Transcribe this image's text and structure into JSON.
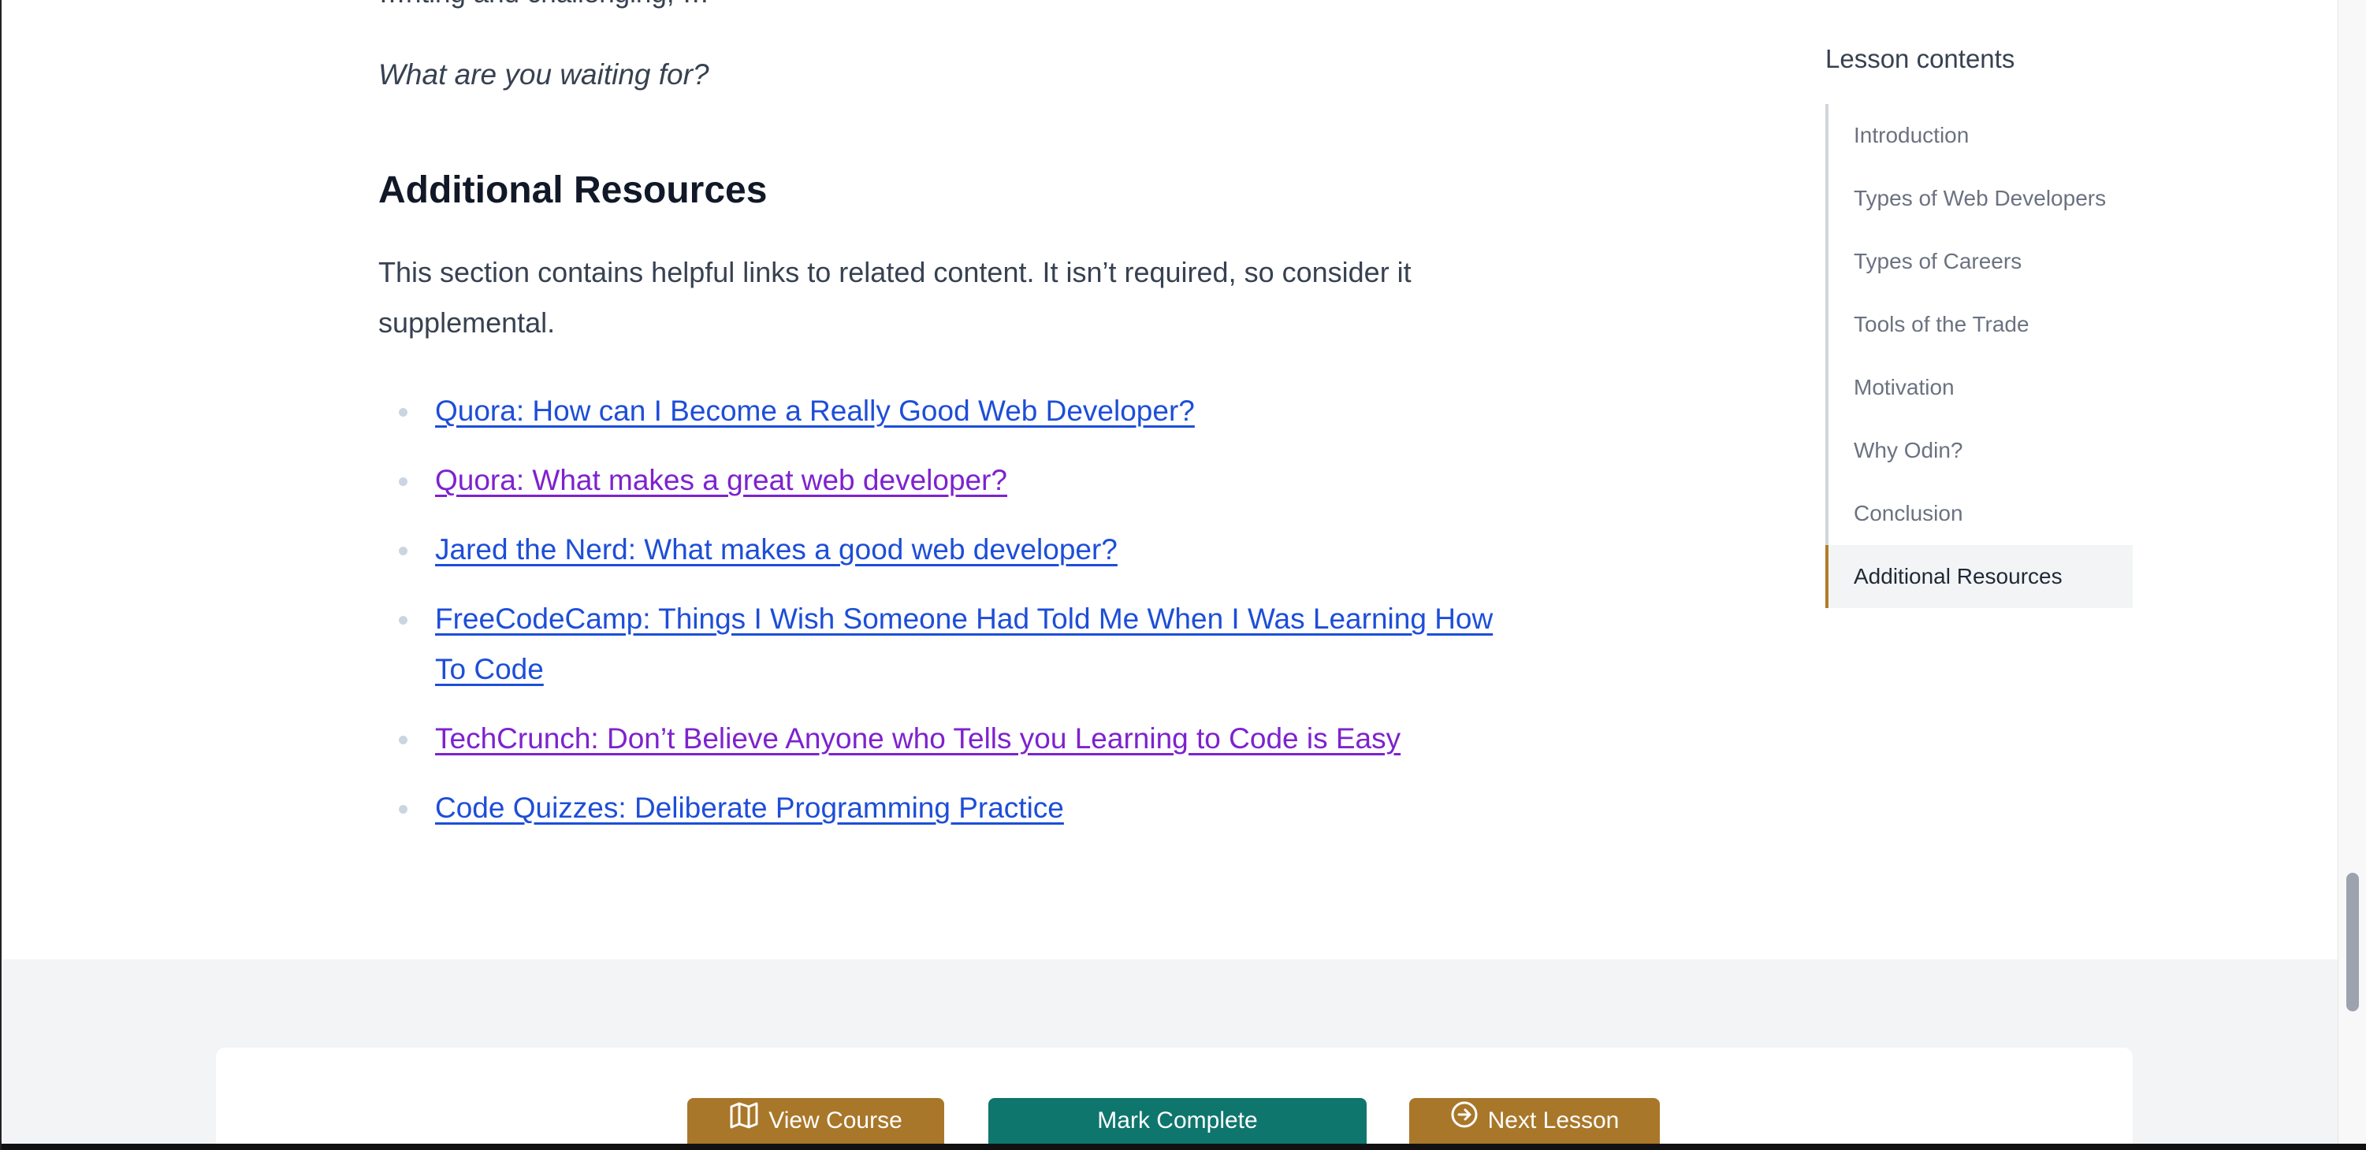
{
  "article": {
    "partial_line": "…nting and challenging, …",
    "closing_question": "What are you waiting for?",
    "section_heading": "Additional Resources",
    "section_intro": "This section contains helpful links to related content. It isn’t required, so consider it supplemental.",
    "resources": [
      {
        "label": "Quora: How can I Become a Really Good Web Developer?",
        "visited": false
      },
      {
        "label": "Quora: What makes a great web developer?",
        "visited": true
      },
      {
        "label": "Jared the Nerd: What makes a good web developer?",
        "visited": false
      },
      {
        "label": "FreeCodeCamp: Things I Wish Someone Had Told Me When I Was Learning How To Code",
        "visited": false
      },
      {
        "label": "TechCrunch: Don’t Believe Anyone who Tells you Learning to Code is Easy",
        "visited": true
      },
      {
        "label": "Code Quizzes: Deliberate Programming Practice",
        "visited": false
      }
    ]
  },
  "toc": {
    "title": "Lesson contents",
    "items": [
      {
        "label": "Introduction",
        "active": false
      },
      {
        "label": "Types of Web Developers",
        "active": false
      },
      {
        "label": "Types of Careers",
        "active": false
      },
      {
        "label": "Tools of the Trade",
        "active": false
      },
      {
        "label": "Motivation",
        "active": false
      },
      {
        "label": "Why Odin?",
        "active": false
      },
      {
        "label": "Conclusion",
        "active": false
      },
      {
        "label": "Additional Resources",
        "active": true
      }
    ]
  },
  "footer": {
    "view_course_label": "View Course",
    "view_course_icon": "map-icon",
    "mark_complete_label": "Mark Complete",
    "next_lesson_label": "Next Lesson",
    "next_lesson_icon": "arrow-circle-right-icon"
  },
  "colors": {
    "link": "#1d4ed8",
    "link_visited": "#7e22ce",
    "gold_button": "#a9772a",
    "teal_button": "#0f766e",
    "toc_active_border": "#b07d2b"
  }
}
